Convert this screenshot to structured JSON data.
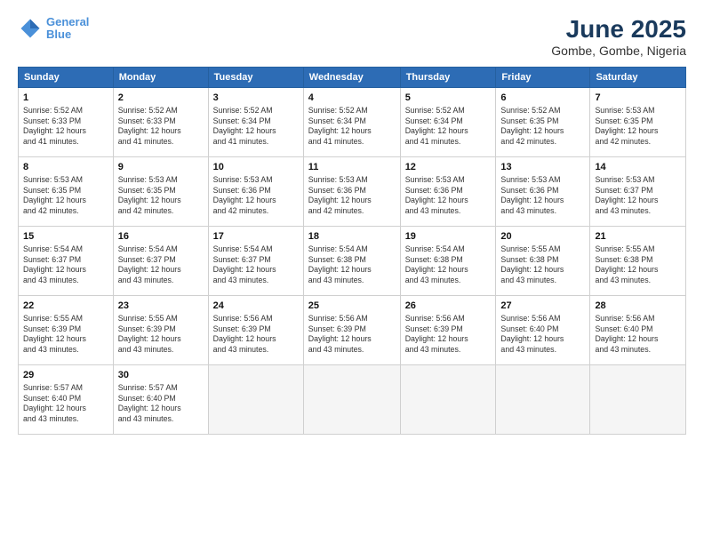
{
  "logo": {
    "line1": "General",
    "line2": "Blue"
  },
  "title": "June 2025",
  "subtitle": "Gombe, Gombe, Nigeria",
  "days_of_week": [
    "Sunday",
    "Monday",
    "Tuesday",
    "Wednesday",
    "Thursday",
    "Friday",
    "Saturday"
  ],
  "weeks": [
    [
      {
        "day": 1,
        "info": "Sunrise: 5:52 AM\nSunset: 6:33 PM\nDaylight: 12 hours\nand 41 minutes."
      },
      {
        "day": 2,
        "info": "Sunrise: 5:52 AM\nSunset: 6:33 PM\nDaylight: 12 hours\nand 41 minutes."
      },
      {
        "day": 3,
        "info": "Sunrise: 5:52 AM\nSunset: 6:34 PM\nDaylight: 12 hours\nand 41 minutes."
      },
      {
        "day": 4,
        "info": "Sunrise: 5:52 AM\nSunset: 6:34 PM\nDaylight: 12 hours\nand 41 minutes."
      },
      {
        "day": 5,
        "info": "Sunrise: 5:52 AM\nSunset: 6:34 PM\nDaylight: 12 hours\nand 41 minutes."
      },
      {
        "day": 6,
        "info": "Sunrise: 5:52 AM\nSunset: 6:35 PM\nDaylight: 12 hours\nand 42 minutes."
      },
      {
        "day": 7,
        "info": "Sunrise: 5:53 AM\nSunset: 6:35 PM\nDaylight: 12 hours\nand 42 minutes."
      }
    ],
    [
      {
        "day": 8,
        "info": "Sunrise: 5:53 AM\nSunset: 6:35 PM\nDaylight: 12 hours\nand 42 minutes."
      },
      {
        "day": 9,
        "info": "Sunrise: 5:53 AM\nSunset: 6:35 PM\nDaylight: 12 hours\nand 42 minutes."
      },
      {
        "day": 10,
        "info": "Sunrise: 5:53 AM\nSunset: 6:36 PM\nDaylight: 12 hours\nand 42 minutes."
      },
      {
        "day": 11,
        "info": "Sunrise: 5:53 AM\nSunset: 6:36 PM\nDaylight: 12 hours\nand 42 minutes."
      },
      {
        "day": 12,
        "info": "Sunrise: 5:53 AM\nSunset: 6:36 PM\nDaylight: 12 hours\nand 43 minutes."
      },
      {
        "day": 13,
        "info": "Sunrise: 5:53 AM\nSunset: 6:36 PM\nDaylight: 12 hours\nand 43 minutes."
      },
      {
        "day": 14,
        "info": "Sunrise: 5:53 AM\nSunset: 6:37 PM\nDaylight: 12 hours\nand 43 minutes."
      }
    ],
    [
      {
        "day": 15,
        "info": "Sunrise: 5:54 AM\nSunset: 6:37 PM\nDaylight: 12 hours\nand 43 minutes."
      },
      {
        "day": 16,
        "info": "Sunrise: 5:54 AM\nSunset: 6:37 PM\nDaylight: 12 hours\nand 43 minutes."
      },
      {
        "day": 17,
        "info": "Sunrise: 5:54 AM\nSunset: 6:37 PM\nDaylight: 12 hours\nand 43 minutes."
      },
      {
        "day": 18,
        "info": "Sunrise: 5:54 AM\nSunset: 6:38 PM\nDaylight: 12 hours\nand 43 minutes."
      },
      {
        "day": 19,
        "info": "Sunrise: 5:54 AM\nSunset: 6:38 PM\nDaylight: 12 hours\nand 43 minutes."
      },
      {
        "day": 20,
        "info": "Sunrise: 5:55 AM\nSunset: 6:38 PM\nDaylight: 12 hours\nand 43 minutes."
      },
      {
        "day": 21,
        "info": "Sunrise: 5:55 AM\nSunset: 6:38 PM\nDaylight: 12 hours\nand 43 minutes."
      }
    ],
    [
      {
        "day": 22,
        "info": "Sunrise: 5:55 AM\nSunset: 6:39 PM\nDaylight: 12 hours\nand 43 minutes."
      },
      {
        "day": 23,
        "info": "Sunrise: 5:55 AM\nSunset: 6:39 PM\nDaylight: 12 hours\nand 43 minutes."
      },
      {
        "day": 24,
        "info": "Sunrise: 5:56 AM\nSunset: 6:39 PM\nDaylight: 12 hours\nand 43 minutes."
      },
      {
        "day": 25,
        "info": "Sunrise: 5:56 AM\nSunset: 6:39 PM\nDaylight: 12 hours\nand 43 minutes."
      },
      {
        "day": 26,
        "info": "Sunrise: 5:56 AM\nSunset: 6:39 PM\nDaylight: 12 hours\nand 43 minutes."
      },
      {
        "day": 27,
        "info": "Sunrise: 5:56 AM\nSunset: 6:40 PM\nDaylight: 12 hours\nand 43 minutes."
      },
      {
        "day": 28,
        "info": "Sunrise: 5:56 AM\nSunset: 6:40 PM\nDaylight: 12 hours\nand 43 minutes."
      }
    ],
    [
      {
        "day": 29,
        "info": "Sunrise: 5:57 AM\nSunset: 6:40 PM\nDaylight: 12 hours\nand 43 minutes."
      },
      {
        "day": 30,
        "info": "Sunrise: 5:57 AM\nSunset: 6:40 PM\nDaylight: 12 hours\nand 43 minutes."
      },
      null,
      null,
      null,
      null,
      null
    ]
  ]
}
